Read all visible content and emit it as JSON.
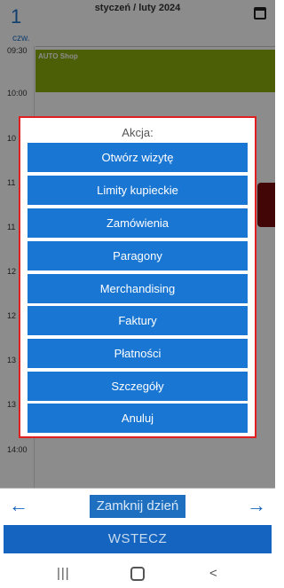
{
  "header": {
    "day_number": "1",
    "month_title": "styczeń / luty 2024",
    "weekday": "czw."
  },
  "times": [
    "09:30",
    "10:00",
    "10",
    "11",
    "11",
    "12",
    "12",
    "13",
    "13",
    "14:00"
  ],
  "event": {
    "title": "AUTO Shop"
  },
  "dialog": {
    "title": "Akcja:",
    "actions": [
      "Otwórz wizytę",
      "Limity kupieckie",
      "Zamówienia",
      "Paragony",
      "Merchandising",
      "Faktury",
      "Płatności",
      "Szczegóły",
      "Anuluj"
    ]
  },
  "footer": {
    "left_arrow": "←",
    "close_day": "Zamknij dzień",
    "right_arrow": "→",
    "back": "WSTECZ"
  },
  "system_nav": {
    "recent": "|||",
    "back": "<"
  }
}
